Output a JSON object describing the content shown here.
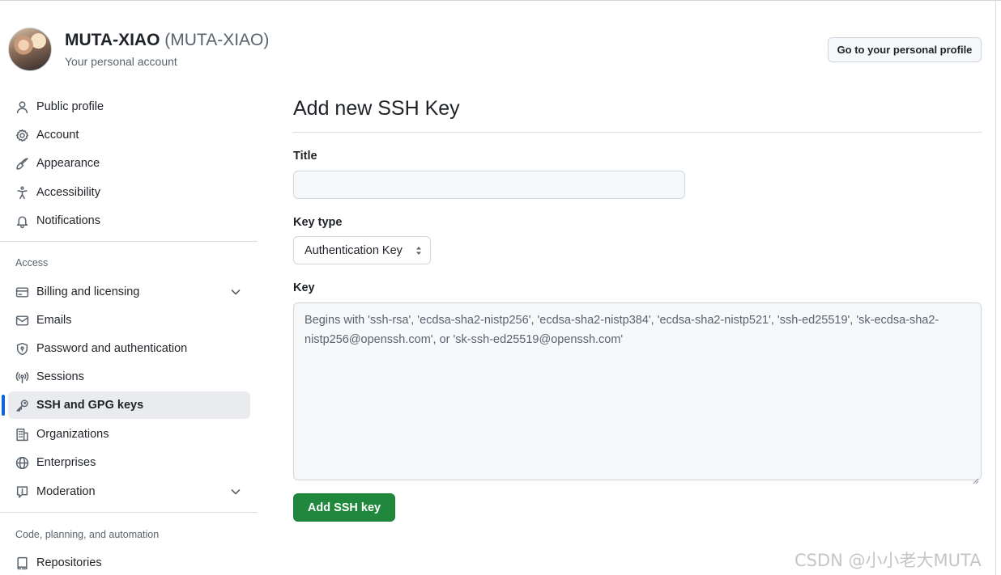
{
  "header": {
    "account_name": "MUTA-XIAO",
    "account_handle": "(MUTA-XIAO)",
    "account_subtitle": "Your personal account",
    "profile_button_label": "Go to your personal profile"
  },
  "sidebar": {
    "items_top": [
      {
        "label": "Public profile",
        "icon": "person-icon"
      },
      {
        "label": "Account",
        "icon": "gear-icon"
      },
      {
        "label": "Appearance",
        "icon": "paintbrush-icon"
      },
      {
        "label": "Accessibility",
        "icon": "accessibility-icon"
      },
      {
        "label": "Notifications",
        "icon": "bell-icon"
      }
    ],
    "access_heading": "Access",
    "items_access": [
      {
        "label": "Billing and licensing",
        "icon": "credit-card-icon"
      },
      {
        "label": "Emails",
        "icon": "mail-icon"
      },
      {
        "label": "Password and authentication",
        "icon": "shield-icon"
      },
      {
        "label": "Sessions",
        "icon": "broadcast-icon"
      },
      {
        "label": "SSH and GPG keys",
        "icon": "key-icon",
        "active": true
      },
      {
        "label": "Organizations",
        "icon": "organization-icon"
      },
      {
        "label": "Enterprises",
        "icon": "globe-icon"
      },
      {
        "label": "Moderation",
        "icon": "report-icon"
      }
    ],
    "code_heading": "Code, planning, and automation",
    "items_code": [
      {
        "label": "Repositories",
        "icon": "repo-icon"
      }
    ]
  },
  "main": {
    "title": "Add new SSH Key",
    "title_field_label": "Title",
    "title_field_value": "",
    "key_type_label": "Key type",
    "key_type_selected": "Authentication Key",
    "key_label": "Key",
    "key_placeholder": "Begins with 'ssh-rsa', 'ecdsa-sha2-nistp256', 'ecdsa-sha2-nistp384', 'ecdsa-sha2-nistp521', 'ssh-ed25519', 'sk-ecdsa-sha2-nistp256@openssh.com', or 'sk-ssh-ed25519@openssh.com'",
    "submit_label": "Add SSH key"
  },
  "watermark": "CSDN @小小老大MUTA",
  "colors": {
    "accent_blue": "#0969da",
    "primary_green": "#1f883d",
    "muted_text": "#59636e",
    "border": "#d0d7de"
  }
}
